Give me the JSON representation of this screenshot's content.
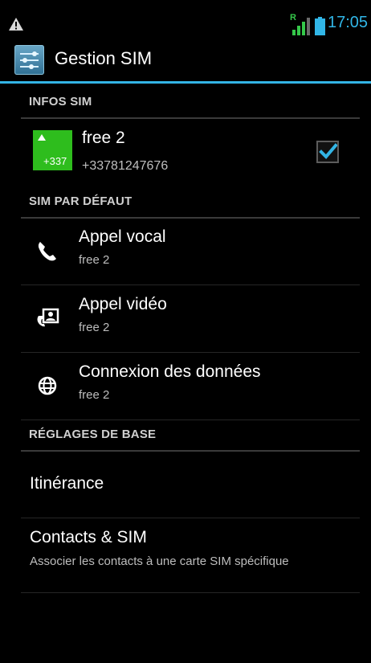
{
  "status_bar": {
    "time": "17:05",
    "roaming_badge": "R",
    "accent_color": "#31b6e7",
    "warning_icon": "warning-icon",
    "signal_icon": "signal-icon",
    "battery_icon": "battery-icon"
  },
  "action_bar": {
    "title": "Gestion SIM",
    "icon": "settings-sliders-icon",
    "accent_color": "#33b5e5"
  },
  "sections": {
    "infos_sim": "INFOS SIM",
    "sim_par_defaut": "SIM PAR DÉFAUT",
    "reglages_de_base": "RÉGLAGES DE BASE"
  },
  "sim_info": {
    "name": "free 2",
    "number": "+33781247676",
    "badge_text": "+337",
    "badge_color": "#2ebd1d",
    "checked": true
  },
  "default_sim": [
    {
      "title": "Appel vocal",
      "subtitle": "free 2",
      "icon": "phone-icon"
    },
    {
      "title": "Appel vidéo",
      "subtitle": "free 2",
      "icon": "video-call-icon"
    },
    {
      "title": "Connexion des données",
      "subtitle": "free 2",
      "icon": "globe-icon"
    }
  ],
  "basic_settings": {
    "itinerance": "Itinérance",
    "contacts_title": "Contacts & SIM",
    "contacts_subtitle": "Associer les contacts à une carte SIM spécifique"
  }
}
